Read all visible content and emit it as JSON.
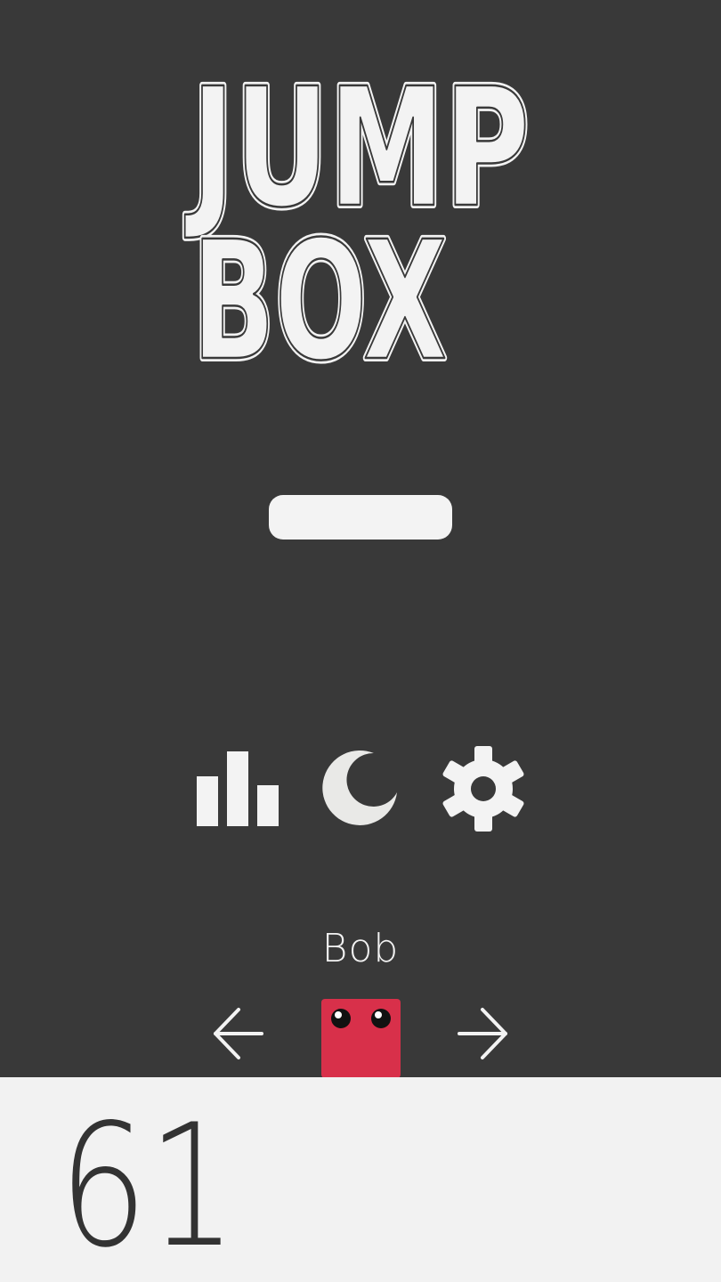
{
  "logo": {
    "line1": "JUMP",
    "line2": "BOX"
  },
  "menu": {
    "play_icon": "play-bar",
    "leaderboard_icon": "bar-chart-icon",
    "night_mode_icon": "moon-icon",
    "settings_icon": "gear-icon"
  },
  "character_selector": {
    "name": "Bob",
    "prev_icon": "arrow-left-icon",
    "next_icon": "arrow-right-icon",
    "character_color": "#d8304a"
  },
  "score": {
    "value": "61"
  },
  "colors": {
    "background": "#393939",
    "foreground": "#f3f3f3",
    "score_panel": "#f2f2f2",
    "score_text": "#333333"
  }
}
